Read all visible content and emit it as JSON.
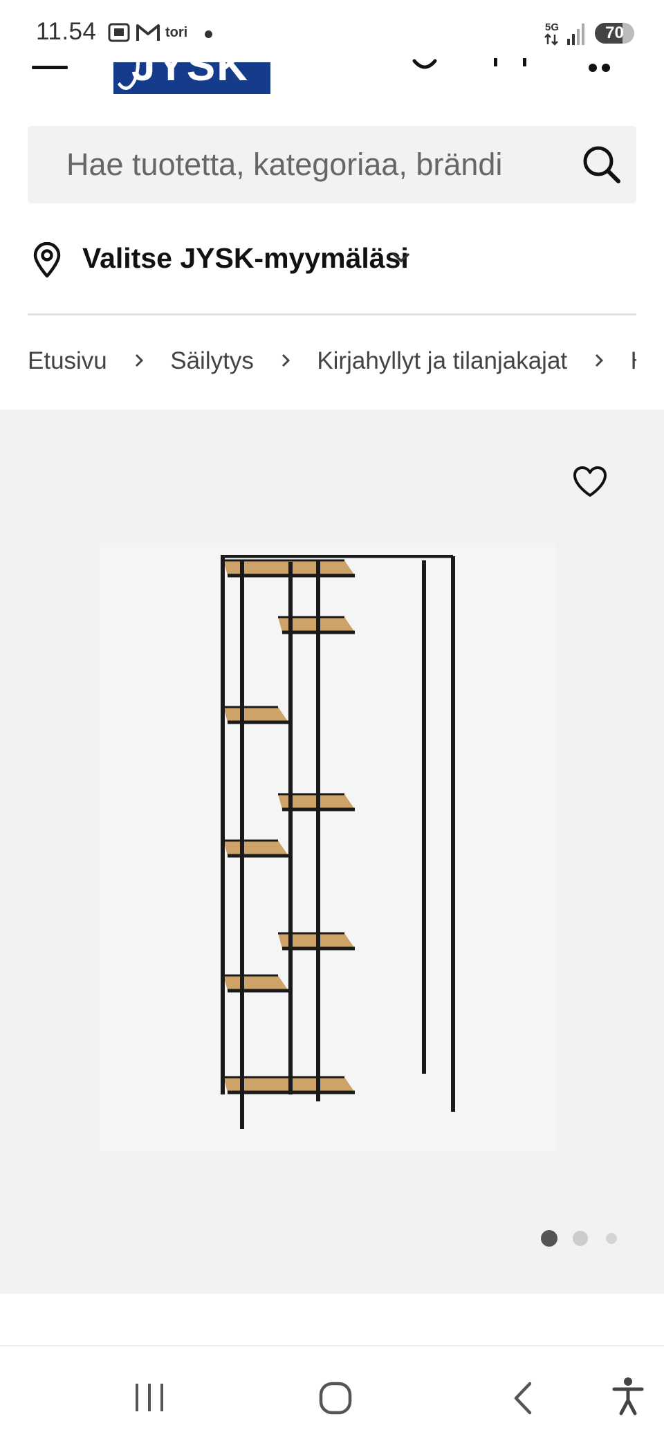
{
  "status_bar": {
    "time": "11.54",
    "tori_label": "tori",
    "network": "5G",
    "battery": "70",
    "battery_level": 0.7
  },
  "header": {
    "logo_text": "JYSK"
  },
  "search": {
    "placeholder": "Hae tuotetta, kategoriaa, brändi"
  },
  "store": {
    "label": "Valitse JYSK-myymäläsi"
  },
  "breadcrumb": [
    "Etusivu",
    "Säilytys",
    "Kirjahyllyt ja tilanjakajat",
    "Hylly"
  ],
  "gallery": {
    "image_count": 3,
    "active_index": 0
  },
  "colors": {
    "brand_blue": "#143c8a",
    "gallery_bg": "#f2f2f2",
    "wood": "#c99a5b",
    "frame": "#1a1a1a"
  },
  "icons": [
    "menu-icon",
    "user-icon",
    "cart-icon",
    "search-icon",
    "location-pin-icon",
    "chevron-down-icon",
    "heart-icon",
    "recent-apps-icon",
    "home-icon",
    "back-icon",
    "accessibility-icon"
  ]
}
